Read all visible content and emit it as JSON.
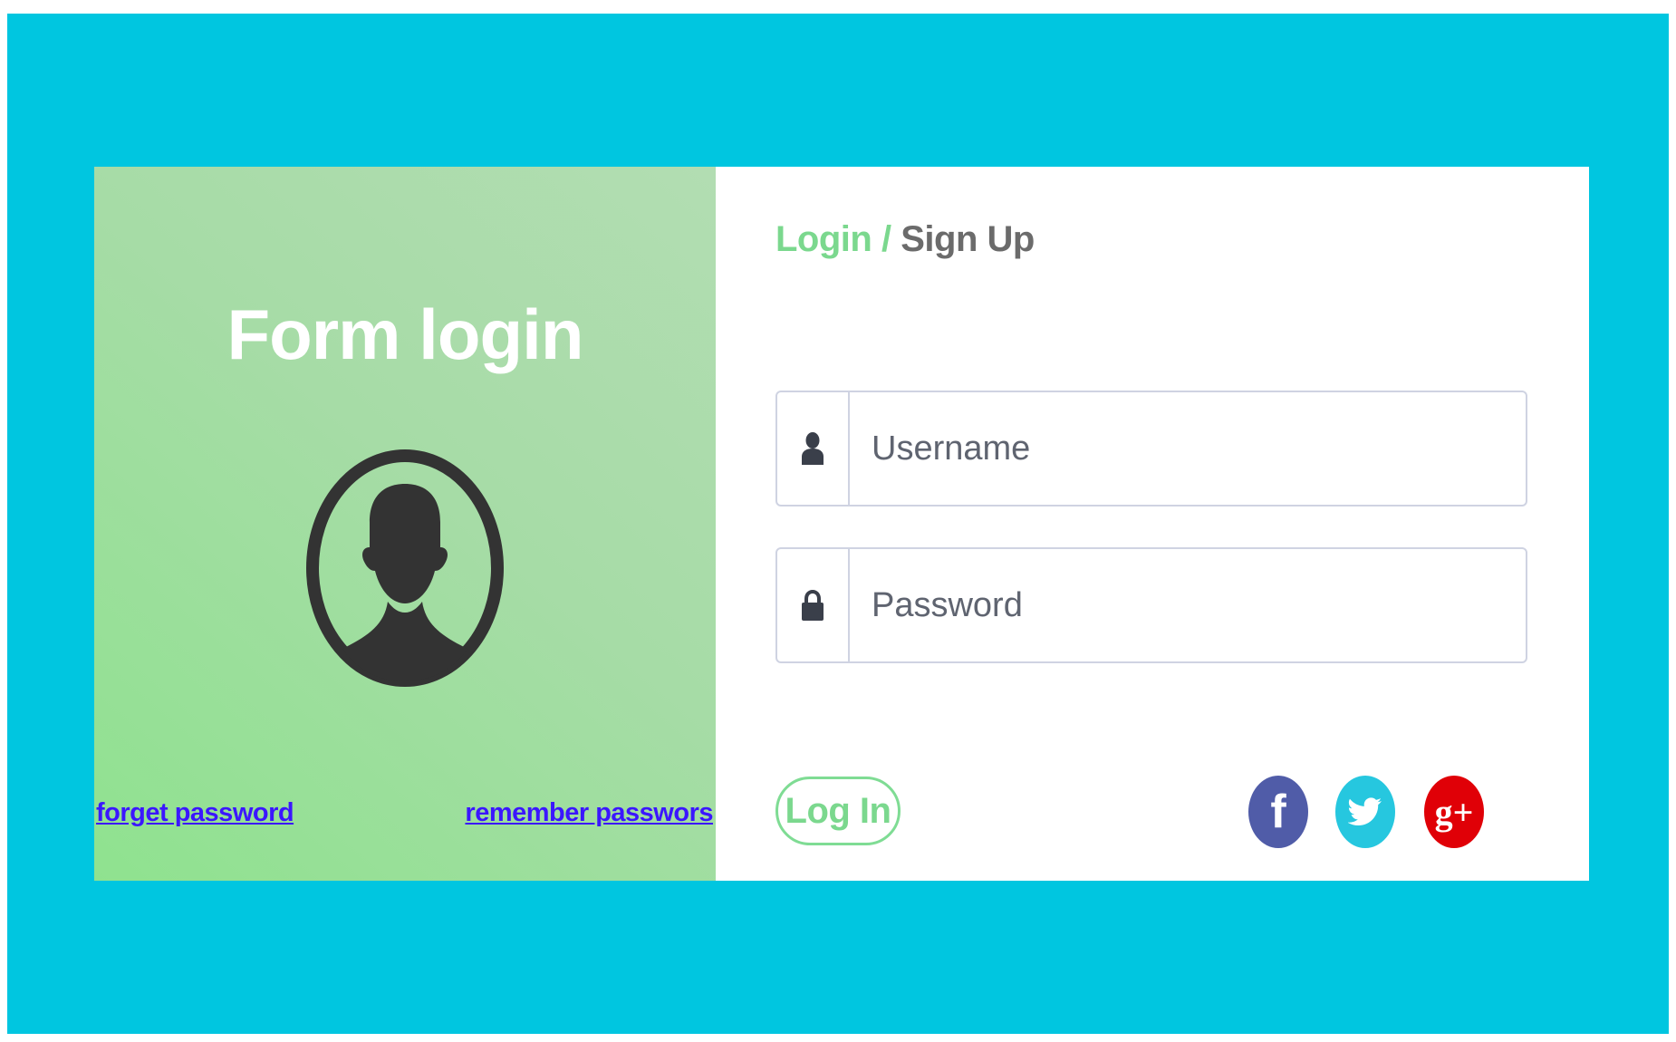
{
  "colors": {
    "page_background": "#00c6e0",
    "left_panel_green": "#9ddf9d",
    "accent_green": "#7bd88e",
    "link_color": "#3b16ff",
    "facebook": "#505ca8",
    "twitter": "#26c7df",
    "google_plus": "#e00007"
  },
  "left_panel": {
    "title": "Form login",
    "avatar_icon": "user-silhouette-icon",
    "links": {
      "forget_password": "forget password",
      "remember_password": "remember passwors"
    }
  },
  "tabs": {
    "login": "Login",
    "separator": "/",
    "signup": "Sign Up"
  },
  "form": {
    "username": {
      "icon": "user-icon",
      "placeholder": "Username",
      "value": ""
    },
    "password": {
      "icon": "lock-icon",
      "placeholder": "Password",
      "value": ""
    },
    "submit_label": "Log In"
  },
  "social": {
    "facebook": {
      "icon": "facebook-icon",
      "glyph": "f"
    },
    "twitter": {
      "icon": "twitter-icon"
    },
    "google_plus": {
      "icon": "google-plus-icon",
      "glyph": "g+"
    }
  }
}
